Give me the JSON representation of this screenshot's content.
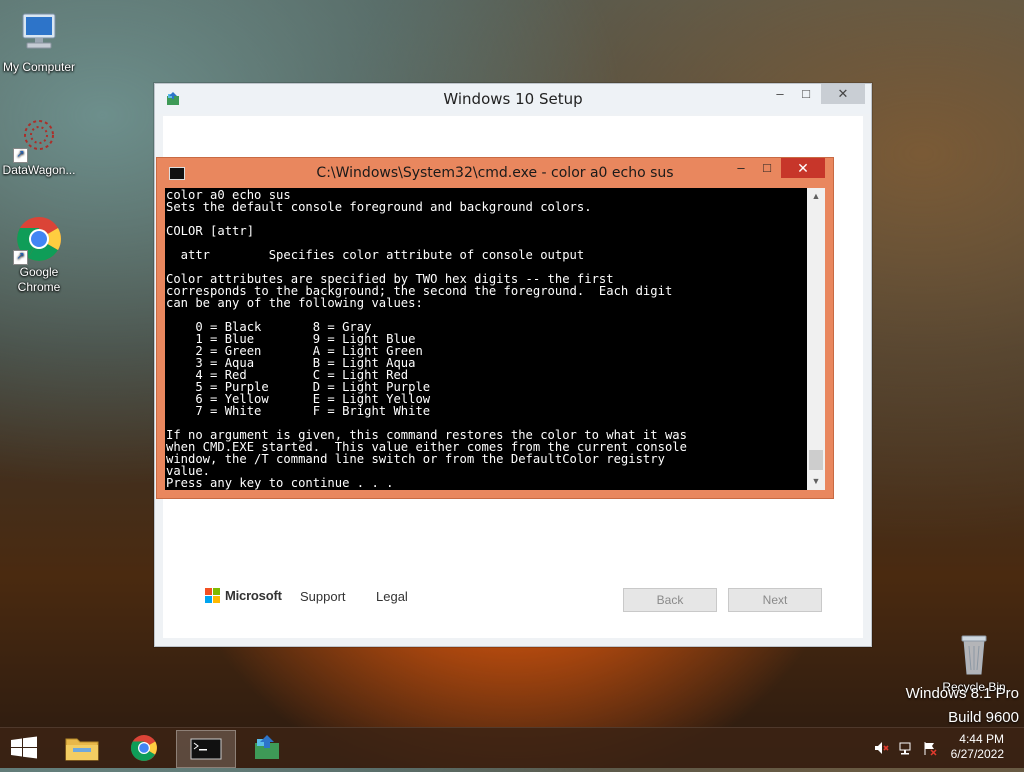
{
  "desktop": {
    "icons": [
      {
        "label": "My Computer"
      },
      {
        "label": "DataWagon..."
      },
      {
        "label": "Google\nChrome"
      },
      {
        "label": "Recycle Bin"
      }
    ]
  },
  "watermark": {
    "line1": "Windows 8.1 Pro",
    "line2": "Build 9600"
  },
  "setup_window": {
    "title": "Windows 10 Setup",
    "controls": {
      "minimize": "–",
      "maximize": "□",
      "close": "✕"
    },
    "footer": {
      "brand": "Microsoft",
      "support": "Support",
      "legal": "Legal",
      "back": "Back",
      "next": "Next"
    },
    "brand_colors": [
      "#f25022",
      "#7fba00",
      "#00a4ef",
      "#ffb900"
    ]
  },
  "cmd_window": {
    "title": "C:\\Windows\\System32\\cmd.exe - color  a0 echo sus",
    "controls": {
      "minimize": "–",
      "maximize": "□",
      "close": "✕"
    },
    "console_text": "color a0 echo sus\nSets the default console foreground and background colors.\n\nCOLOR [attr]\n\n  attr        Specifies color attribute of console output\n\nColor attributes are specified by TWO hex digits -- the first\ncorresponds to the background; the second the foreground.  Each digit\ncan be any of the following values:\n\n    0 = Black       8 = Gray\n    1 = Blue        9 = Light Blue\n    2 = Green       A = Light Green\n    3 = Aqua        B = Light Aqua\n    4 = Red         C = Light Red\n    5 = Purple      D = Light Purple\n    6 = Yellow      E = Light Yellow\n    7 = White       F = Bright White\n\nIf no argument is given, this command restores the color to what it was\nwhen CMD.EXE started.  This value either comes from the current console\nwindow, the /T command line switch or from the DefaultColor registry\nvalue.\nPress any key to continue . . ."
  },
  "taskbar": {
    "clock_time": "4:44 PM",
    "clock_date": "6/27/2022"
  }
}
